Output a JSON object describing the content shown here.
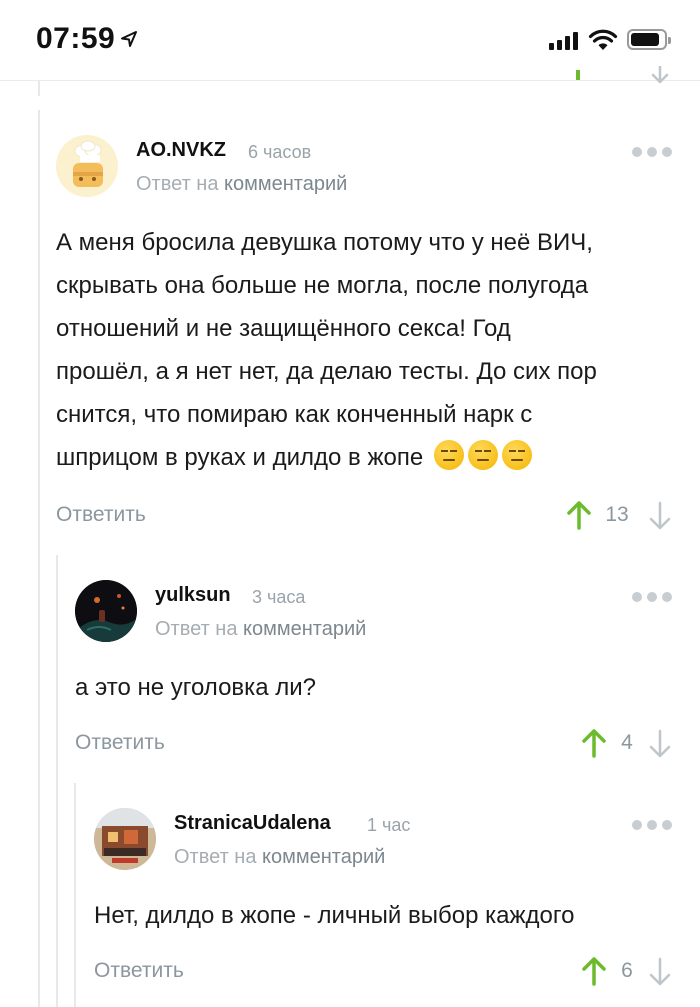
{
  "status_bar": {
    "time": "07:59"
  },
  "colors": {
    "accent_green": "#6cbb2c",
    "muted_text": "#8b979e",
    "link_text": "#7c878e"
  },
  "comments": [
    {
      "username": "AO.NVKZ",
      "time_ago": "6 часов",
      "reply_prefix": "Ответ на",
      "reply_link": "комментарий",
      "lines": [
        "А меня бросила девушка потому что у неё ВИЧ,",
        "скрывать она больше не могла, после полугода",
        "отношений и не защищённого секса! Год",
        "прошёл, а я нет нет, да делаю тесты. До сих пор",
        "снится, что помираю как конченный нарк с",
        "шприцом в руках и дилдо в жопе"
      ],
      "emoji": [
        "😑",
        "😑",
        "😑"
      ],
      "reply_label": "Ответить",
      "votes": "13"
    },
    {
      "username": "yulksun",
      "time_ago": "3 часа",
      "reply_prefix": "Ответ на",
      "reply_link": "комментарий",
      "lines": [
        "а это не уголовка ли?"
      ],
      "reply_label": "Ответить",
      "votes": "4"
    },
    {
      "username": "StranicaUdalena",
      "time_ago": "1 час",
      "reply_prefix": "Ответ на",
      "reply_link": "комментарий",
      "lines": [
        "Нет, дилдо в жопе - личный выбор каждого"
      ],
      "reply_label": "Ответить",
      "votes": "6"
    }
  ]
}
